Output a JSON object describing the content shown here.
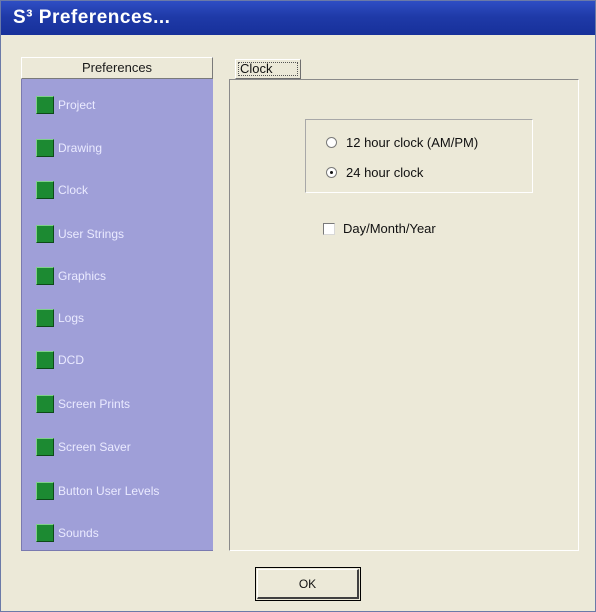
{
  "window": {
    "title": "S³ Preferences..."
  },
  "sidebar": {
    "header": "Preferences",
    "items": [
      {
        "label": "Project"
      },
      {
        "label": "Drawing"
      },
      {
        "label": "Clock"
      },
      {
        "label": "User Strings"
      },
      {
        "label": "Graphics"
      },
      {
        "label": "Logs"
      },
      {
        "label": "DCD"
      },
      {
        "label": "Screen Prints"
      },
      {
        "label": "Screen Saver"
      },
      {
        "label": "Button User Levels"
      },
      {
        "label": "Sounds"
      }
    ]
  },
  "panel": {
    "tab_label": "Clock",
    "radio_options": [
      {
        "label": "12 hour clock (AM/PM)",
        "selected": false
      },
      {
        "label": "24 hour clock",
        "selected": true
      }
    ],
    "checkbox": {
      "label": "Day/Month/Year",
      "checked": false
    }
  },
  "footer": {
    "ok_label": "OK"
  },
  "colors": {
    "titlebar": "#1f3aa8",
    "sidebar": "#9f9fd8",
    "item_square": "#1c8a32",
    "window_bg": "#ece9d8"
  },
  "icons": {
    "item_square": "green-square-icon"
  }
}
